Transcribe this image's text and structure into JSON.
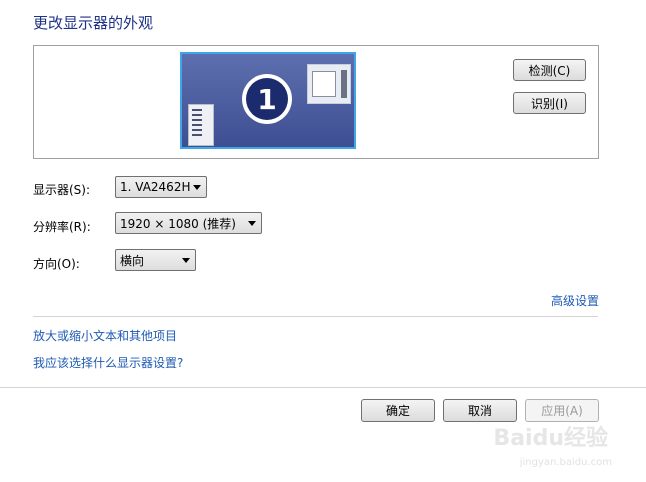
{
  "header": {
    "title": "更改显示器的外观"
  },
  "monitor_panel": {
    "monitor_number": "1",
    "detect_button": "检测(C)",
    "identify_button": "识别(I)"
  },
  "settings": {
    "display_label": "显示器(S):",
    "display_value": "1. VA2462H",
    "resolution_label": "分辨率(R):",
    "resolution_value": "1920 × 1080 (推荐)",
    "orientation_label": "方向(O):",
    "orientation_value": "横向"
  },
  "links": {
    "advanced": "高级设置",
    "text_size": "放大或缩小文本和其他项目",
    "which_settings": "我应该选择什么显示器设置?"
  },
  "footer": {
    "ok": "确定",
    "cancel": "取消",
    "apply": "应用(A)"
  },
  "watermark": {
    "brand": "Baidu经验",
    "url": "jingyan.baidu.com"
  }
}
